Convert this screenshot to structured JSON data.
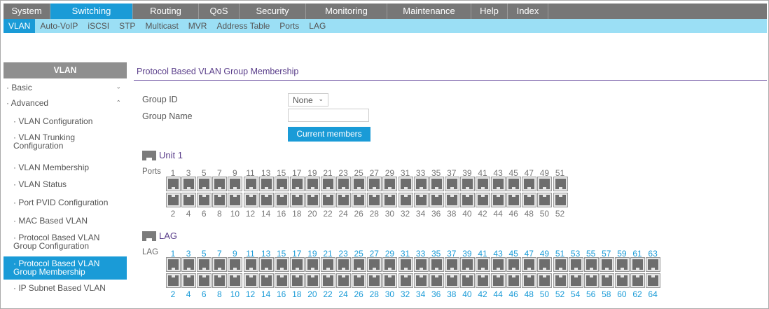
{
  "topnav": [
    "System",
    "Switching",
    "Routing",
    "QoS",
    "Security",
    "Monitoring",
    "Maintenance",
    "Help",
    "Index"
  ],
  "subnav": [
    "VLAN",
    "Auto-VoIP",
    "iSCSI",
    "STP",
    "Multicast",
    "MVR",
    "Address Table",
    "Ports",
    "LAG"
  ],
  "sidebar": {
    "title": "VLAN",
    "items": [
      {
        "label": "Basic"
      },
      {
        "label": "Advanced"
      },
      {
        "label": "VLAN Configuration"
      },
      {
        "label": "VLAN Trunking Configuration"
      },
      {
        "label": "VLAN Membership"
      },
      {
        "label": "VLAN Status"
      },
      {
        "label": "Port PVID Configuration"
      },
      {
        "label": "MAC Based VLAN"
      },
      {
        "label": "Protocol Based VLAN Group Configuration"
      },
      {
        "label": "Protocol Based VLAN Group Membership"
      },
      {
        "label": "IP Subnet Based VLAN"
      }
    ]
  },
  "main": {
    "title": "Protocol Based VLAN Group Membership",
    "group_id_label": "Group ID",
    "group_id_value": "None",
    "group_name_label": "Group Name",
    "group_name_value": "",
    "current_members_button": "Current members",
    "unit_title": "Unit 1",
    "ports_label": "Ports",
    "lag_title": "LAG",
    "lag_label": "LAG"
  },
  "colors": {
    "accent": "#1a9bd7",
    "subnav": "#9bdff5",
    "topnav": "#777777",
    "title": "#5a3e8a"
  }
}
